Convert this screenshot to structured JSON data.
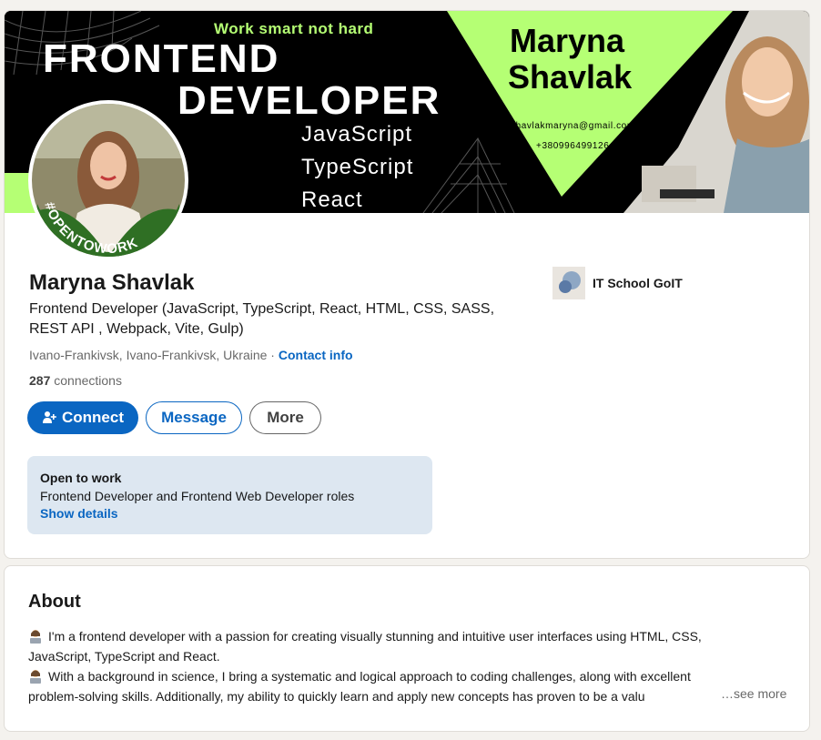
{
  "banner": {
    "tagline": "Work smart not hard",
    "title_line1": "FRONTEND",
    "title_line2": "DEVELOPER",
    "tech": [
      "JavaScript",
      "TypeScript",
      "React"
    ],
    "name_line1": "Maryna",
    "name_line2": "Shavlak",
    "email": "shavlakmaryna@gmail.com",
    "phone": "+380996499126",
    "accent_color": "#b5ff74"
  },
  "avatar": {
    "badge_text": "#OPENTOWORK",
    "badge_color": "#2f6f24"
  },
  "profile": {
    "name": "Maryna Shavlak",
    "headline": "Frontend Developer (JavaScript, TypeScript, React, HTML, CSS, SASS, REST API , Webpack, Vite, Gulp)",
    "location": "Ivano-Frankivsk, Ivano-Frankivsk, Ukraine",
    "separator": " · ",
    "contact_info_label": "Contact info",
    "connections_count": "287",
    "connections_label": " connections",
    "company_name": "IT School GoIT",
    "company_icon": "company-logo-icon"
  },
  "actions": {
    "connect_label": "Connect",
    "connect_icon": "add-person-icon",
    "message_label": "Message",
    "more_label": "More",
    "primary_color": "#0a66c2"
  },
  "open_to_work": {
    "title": "Open to work",
    "roles": "Frontend Developer and Frontend Web Developer roles",
    "link_label": "Show details",
    "background": "#dde7f1"
  },
  "about": {
    "title": "About",
    "line1": "I'm a frontend developer with a passion for creating visually stunning and intuitive user interfaces using HTML, CSS,",
    "line2": "JavaScript, TypeScript and React.",
    "line3": "With a background in science, I bring a systematic and logical approach to coding challenges, along with excellent",
    "line4": "problem-solving skills. Additionally, my ability to quickly learn and apply new concepts has proven to be a valu",
    "emoji_icon": "woman-technologist-icon",
    "see_more_label": "…see more"
  }
}
